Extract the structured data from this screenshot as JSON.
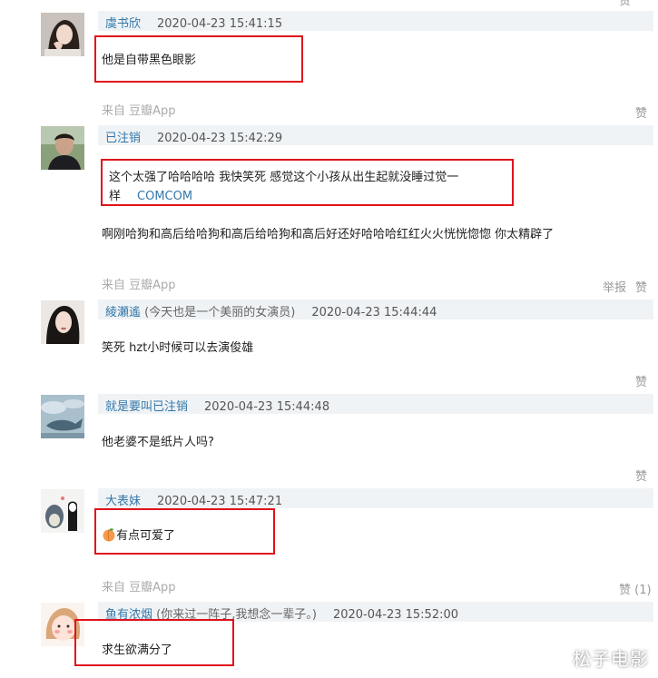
{
  "top_partial_label": "赞",
  "comments": [
    {
      "username": "虞书欣",
      "extra": "",
      "timestamp": "2020-04-23 15:41:15",
      "text": "他是自带黑色眼影",
      "source_prefix": "来自",
      "source_app": "豆瓣App",
      "actions": [
        "赞"
      ],
      "avatar": "avatar-woman-hand-on-face"
    },
    {
      "username": "已注销",
      "extra": "",
      "timestamp": "2020-04-23 15:42:29",
      "quote_line1": "这个太强了哈哈哈哈 我快笑死 感觉这个小孩从出生起就没睡过觉一",
      "quote_line2_text": "样",
      "quote_line2_link": "COMCOM",
      "text": "啊刚哈狗和高后给哈狗和高后给哈狗和高后好还好哈哈哈红红火火恍恍惚惚 你太精辟了",
      "source_prefix": "来自",
      "source_app": "豆瓣App",
      "actions": [
        "举报",
        "赞"
      ],
      "avatar": "avatar-man-outdoor"
    },
    {
      "username": "綾瀬遙",
      "extra": "(今天也是一个美丽的女演员)",
      "timestamp": "2020-04-23 15:44:44",
      "text": "笑死 hzt小时候可以去演俊雄",
      "actions": [
        "赞"
      ],
      "avatar": "avatar-woman-portrait"
    },
    {
      "username": "就是要叫已注销",
      "extra": "",
      "timestamp": "2020-04-23 15:44:48",
      "text": "他老婆不是纸片人吗?",
      "actions": [
        "赞"
      ],
      "avatar": "avatar-whale-sky"
    },
    {
      "username": "大表妹",
      "extra": "",
      "timestamp": "2020-04-23 15:47:21",
      "emoji": "peach-emoji",
      "text": "有点可爱了",
      "source_prefix": "来自",
      "source_app": "豆瓣App",
      "actions": [
        "赞 (1)"
      ],
      "avatar": "avatar-cartoon-totoro"
    },
    {
      "username": "鱼有浓烟",
      "extra": "(你来过一阵子,我想念一辈子。)",
      "timestamp": "2020-04-23 15:52:00",
      "text": "求生欲满分了",
      "avatar": "avatar-cartoon-girl"
    }
  ],
  "watermark": "松子电影",
  "colors": {
    "username": "#3377aa",
    "header_bg": "#f0f3f5",
    "highlight_box": "#e0121c",
    "muted": "#aaaaaa"
  }
}
